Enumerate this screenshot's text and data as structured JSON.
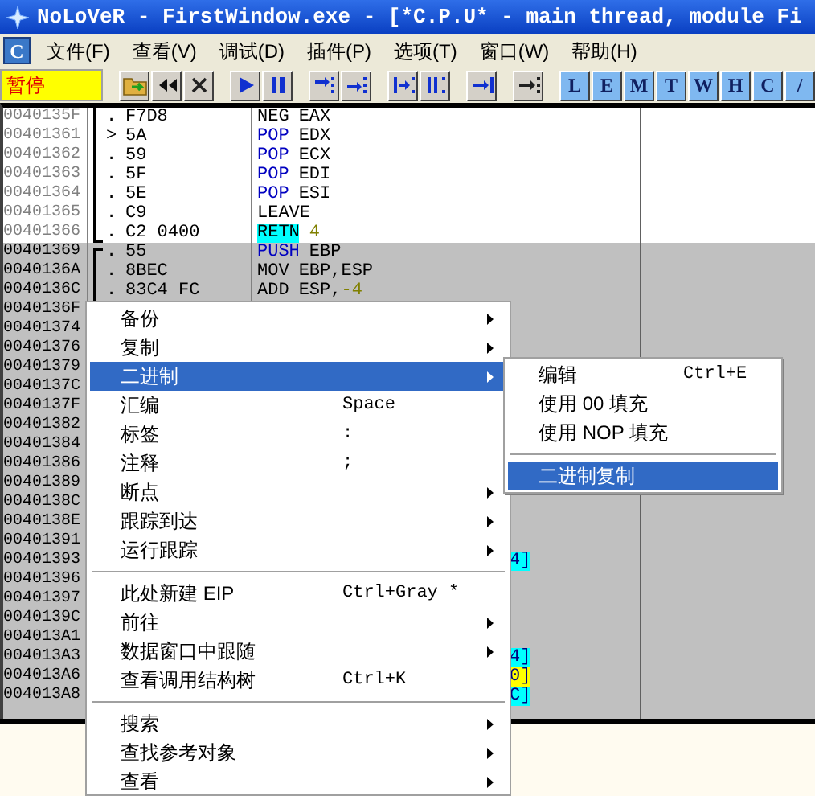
{
  "window": {
    "title": "NoLoVeR - FirstWindow.exe - [*C.P.U* - main thread, module Fi"
  },
  "menu_bar": {
    "cpu_button": "C",
    "items": [
      "文件(F)",
      "查看(V)",
      "调试(D)",
      "插件(P)",
      "选项(T)",
      "窗口(W)",
      "帮助(H)"
    ]
  },
  "toolbar": {
    "status": "暂停",
    "groups": [
      [
        {
          "kind": "open"
        },
        {
          "kind": "rewind"
        },
        {
          "kind": "close"
        }
      ],
      [
        {
          "kind": "play"
        },
        {
          "kind": "pause"
        }
      ],
      [
        {
          "kind": "step-into"
        },
        {
          "kind": "step-over"
        }
      ],
      [
        {
          "kind": "trace-into"
        },
        {
          "kind": "trace-over"
        }
      ],
      [
        {
          "kind": "till-return"
        }
      ],
      [
        {
          "kind": "goto"
        }
      ],
      [
        {
          "kind": "letter",
          "label": "L"
        },
        {
          "kind": "letter",
          "label": "E"
        },
        {
          "kind": "letter",
          "label": "M"
        },
        {
          "kind": "letter",
          "label": "T"
        },
        {
          "kind": "letter",
          "label": "W"
        },
        {
          "kind": "letter",
          "label": "H"
        },
        {
          "kind": "letter",
          "label": "C"
        },
        {
          "kind": "letter",
          "label": "/"
        }
      ]
    ]
  },
  "disassembly": {
    "rows": [
      {
        "address": "0040135F",
        "selected": false,
        "bracket_top": false,
        "bracket_bottom": false,
        "mark": ".",
        "hex": "F7D8",
        "mnemonic": "NEG",
        "kind": "plain",
        "operands": "EAX"
      },
      {
        "address": "00401361",
        "selected": false,
        "bracket_top": false,
        "bracket_bottom": false,
        "mark": ">",
        "hex": "5A",
        "mnemonic": "POP",
        "kind": "stack",
        "operands": "EDX"
      },
      {
        "address": "00401362",
        "selected": false,
        "bracket_top": false,
        "bracket_bottom": false,
        "mark": ".",
        "hex": "59",
        "mnemonic": "POP",
        "kind": "stack",
        "operands": "ECX"
      },
      {
        "address": "00401363",
        "selected": false,
        "bracket_top": false,
        "bracket_bottom": false,
        "mark": ".",
        "hex": "5F",
        "mnemonic": "POP",
        "kind": "stack",
        "operands": "EDI"
      },
      {
        "address": "00401364",
        "selected": false,
        "bracket_top": false,
        "bracket_bottom": false,
        "mark": ".",
        "hex": "5E",
        "mnemonic": "POP",
        "kind": "stack",
        "operands": "ESI"
      },
      {
        "address": "00401365",
        "selected": false,
        "bracket_top": false,
        "bracket_bottom": false,
        "mark": ".",
        "hex": "C9",
        "mnemonic": "LEAVE",
        "kind": "plain"
      },
      {
        "address": "00401366",
        "selected": false,
        "bracket_top": false,
        "bracket_bottom": true,
        "mark": ".",
        "hex": "C2 0400",
        "mnemonic": "RETN",
        "kind": "return",
        "constant": "4"
      },
      {
        "address": "00401369",
        "selected": true,
        "bracket_top": true,
        "bracket_bottom": false,
        "mark": ".",
        "hex": "55",
        "mnemonic": "PUSH",
        "kind": "stack",
        "operands": "EBP"
      },
      {
        "address": "0040136A",
        "selected": true,
        "bracket_top": false,
        "bracket_bottom": false,
        "mark": ".",
        "hex": "8BEC",
        "mnemonic": "MOV",
        "kind": "plain",
        "operands": "EBP,ESP"
      },
      {
        "address": "0040136C",
        "selected": true,
        "bracket_top": false,
        "bracket_bottom": false,
        "mark": ".",
        "hex": "83C4 FC",
        "mnemonic": "ADD",
        "kind": "plain",
        "operands": "ESP,",
        "constant": "-4"
      },
      {
        "address": "0040136F",
        "selected": true
      },
      {
        "address": "00401374",
        "selected": true
      },
      {
        "address": "00401376",
        "selected": true
      },
      {
        "address": "00401379",
        "selected": true
      },
      {
        "address": "0040137C",
        "selected": true
      },
      {
        "address": "0040137F",
        "selected": true
      },
      {
        "address": "00401382",
        "selected": true
      },
      {
        "address": "00401384",
        "selected": true
      },
      {
        "address": "00401386",
        "selected": true
      },
      {
        "address": "00401389",
        "selected": true
      },
      {
        "address": "0040138C",
        "selected": true
      },
      {
        "address": "0040138E",
        "selected": true
      },
      {
        "address": "00401391",
        "selected": true
      },
      {
        "address": "00401393",
        "selected": true,
        "tail": "4]",
        "color": "#00ffff"
      },
      {
        "address": "00401396",
        "selected": true
      },
      {
        "address": "00401397",
        "selected": true
      },
      {
        "address": "0040139C",
        "selected": true
      },
      {
        "address": "004013A1",
        "selected": true
      },
      {
        "address": "004013A3",
        "selected": true,
        "tail": "4]",
        "color": "#00ffff"
      },
      {
        "address": "004013A6",
        "selected": true,
        "tail": "0]",
        "color": "#ffff00"
      },
      {
        "address": "004013A8",
        "selected": true,
        "tail": "C]",
        "color": "#00ffff"
      }
    ]
  },
  "context_menu": {
    "items": [
      {
        "kind": "item",
        "label": "备份",
        "submenu": true,
        "selected": false
      },
      {
        "kind": "item",
        "label": "复制",
        "submenu": true,
        "selected": false
      },
      {
        "kind": "item",
        "label": "二进制",
        "submenu": true,
        "selected": true
      },
      {
        "kind": "item",
        "label": "汇编",
        "shortcut": "Space",
        "submenu": false,
        "selected": false
      },
      {
        "kind": "item",
        "label": "标签",
        "shortcut": ":",
        "submenu": false,
        "selected": false
      },
      {
        "kind": "item",
        "label": "注释",
        "shortcut": ";",
        "submenu": false,
        "selected": false
      },
      {
        "kind": "item",
        "label": "断点",
        "submenu": true,
        "selected": false
      },
      {
        "kind": "item",
        "label": "跟踪到达",
        "submenu": true,
        "selected": false
      },
      {
        "kind": "item",
        "label": "运行跟踪",
        "submenu": true,
        "selected": false
      },
      {
        "kind": "separator"
      },
      {
        "kind": "item",
        "label": "此处新建 EIP",
        "shortcut": "Ctrl+Gray *",
        "submenu": false,
        "selected": false
      },
      {
        "kind": "item",
        "label": "前往",
        "submenu": true,
        "selected": false
      },
      {
        "kind": "item",
        "label": "数据窗口中跟随",
        "submenu": true,
        "selected": false
      },
      {
        "kind": "item",
        "label": "查看调用结构树",
        "shortcut": "Ctrl+K",
        "submenu": false,
        "selected": false
      },
      {
        "kind": "separator"
      },
      {
        "kind": "item",
        "label": "搜索",
        "submenu": true,
        "selected": false
      },
      {
        "kind": "item",
        "label": "查找参考对象",
        "submenu": true,
        "selected": false
      },
      {
        "kind": "item",
        "label": "查看",
        "submenu": true,
        "selected": false
      }
    ]
  },
  "submenu": {
    "items": [
      {
        "kind": "item",
        "label": "编辑",
        "shortcut": "Ctrl+E",
        "selected": false
      },
      {
        "kind": "item",
        "label": "使用 00 填充",
        "selected": false
      },
      {
        "kind": "item",
        "label": "使用 NOP 填充",
        "selected": false
      },
      {
        "kind": "separator"
      },
      {
        "kind": "item",
        "label": "二进制复制",
        "selected": true
      }
    ]
  }
}
